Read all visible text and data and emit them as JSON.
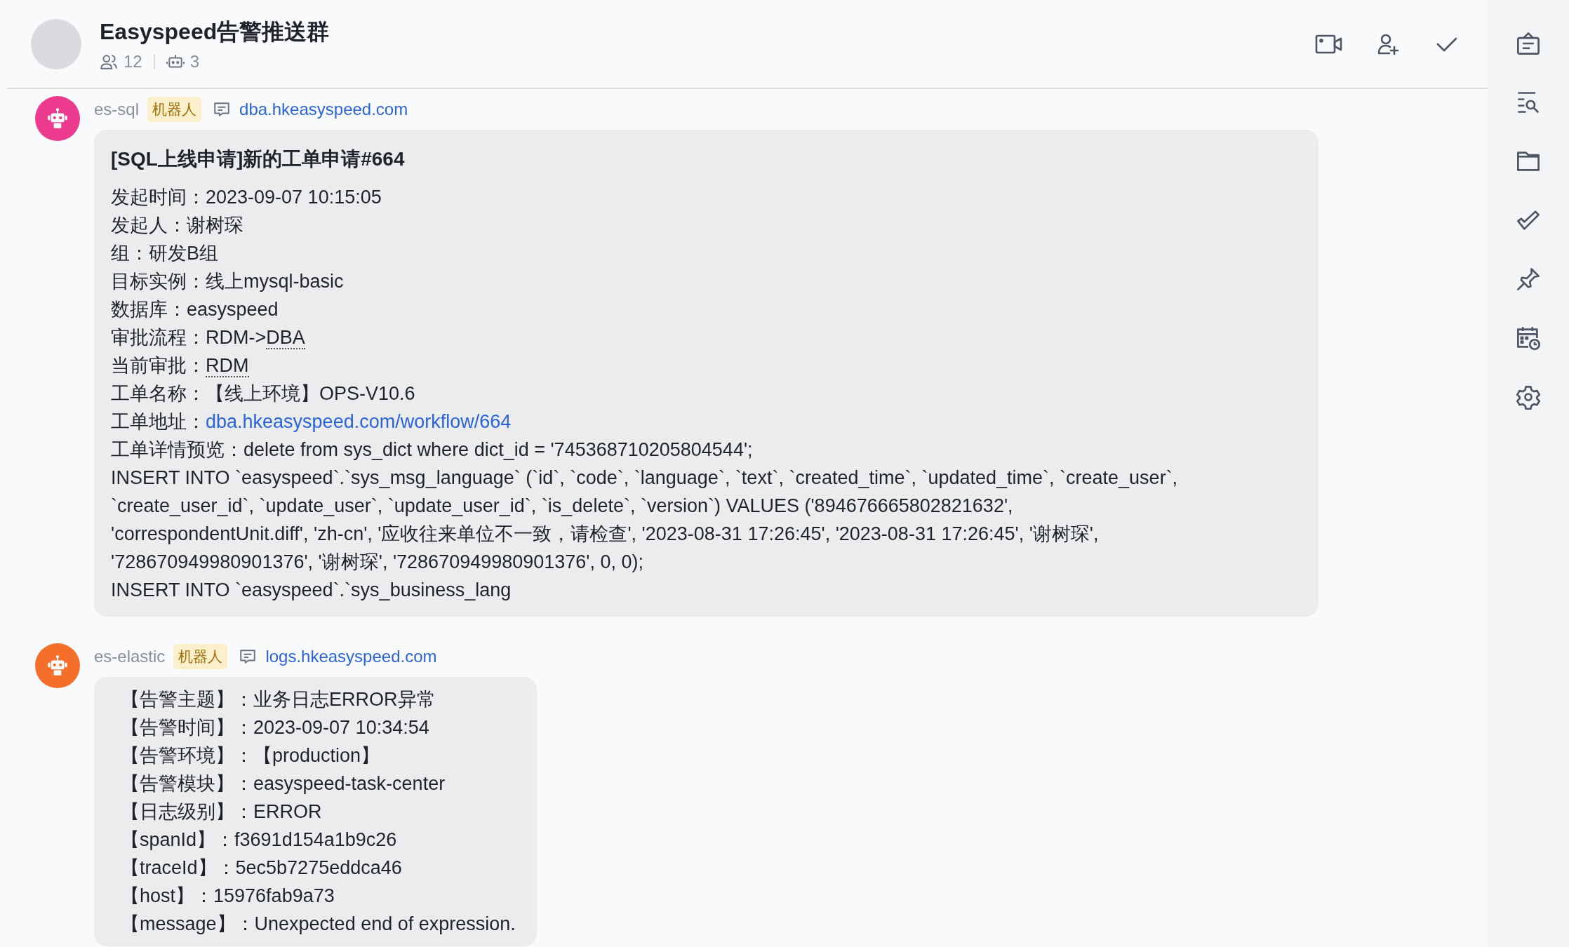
{
  "header": {
    "title": "Easyspeed告警推送群",
    "members": "12",
    "bots": "3"
  },
  "messages": [
    {
      "sender": "es-sql",
      "tag": "机器人",
      "link": "dba.hkeasyspeed.com",
      "color": "#ec3a8e",
      "title": "[SQL上线申请]新的工单申请#664",
      "lines": [
        [
          {
            "text": "发起时间：2023-09-07 10:15:05",
            "kind": "text"
          }
        ],
        [
          {
            "text": "发起人：谢树琛",
            "kind": "text"
          }
        ],
        [
          {
            "text": "组：研发B组",
            "kind": "text"
          }
        ],
        [
          {
            "text": "目标实例：线上mysql-basic",
            "kind": "text"
          }
        ],
        [
          {
            "text": "数据库：easyspeed",
            "kind": "text"
          }
        ],
        [
          {
            "text": "审批流程：RDM->",
            "kind": "text"
          },
          {
            "text": "DBA",
            "kind": "term"
          }
        ],
        [
          {
            "text": "当前审批：",
            "kind": "text"
          },
          {
            "text": "RDM",
            "kind": "term"
          }
        ],
        [
          {
            "text": "工单名称：【线上环境】OPS-V10.6",
            "kind": "text"
          }
        ],
        [
          {
            "text": "工单地址：",
            "kind": "text"
          },
          {
            "text": "dba.hkeasyspeed.com/workflow/664",
            "kind": "link"
          }
        ],
        [
          {
            "text": "工单详情预览：delete from sys_dict where dict_id = '745368710205804544';",
            "kind": "text"
          }
        ],
        [
          {
            "text": "INSERT INTO `easyspeed`.`sys_msg_language` (`id`, `code`, `language`, `text`, `created_time`, `updated_time`, `create_user`,",
            "kind": "text"
          }
        ],
        [
          {
            "text": "`create_user_id`, `update_user`, `update_user_id`, `is_delete`, `version`) VALUES ('894676665802821632',",
            "kind": "text"
          }
        ],
        [
          {
            "text": "'correspondentUnit.diff', 'zh-cn', '应收往来单位不一致，请检查', '2023-08-31 17:26:45', '2023-08-31 17:26:45', '谢树琛',",
            "kind": "text"
          }
        ],
        [
          {
            "text": "'728670949980901376', '谢树琛', '728670949980901376', 0, 0);",
            "kind": "text"
          }
        ],
        [
          {
            "text": "INSERT INTO `easyspeed`.`sys_business_lang",
            "kind": "text"
          }
        ]
      ]
    },
    {
      "sender": "es-elastic",
      "tag": "机器人",
      "link": "logs.hkeasyspeed.com",
      "color": "#f4702a",
      "lines": [
        [
          {
            "text": "【告警主题】：业务日志ERROR异常",
            "kind": "text"
          }
        ],
        [
          {
            "text": "【告警时间】：2023-09-07 10:34:54",
            "kind": "text"
          }
        ],
        [
          {
            "text": "【告警环境】：【production】",
            "kind": "text"
          }
        ],
        [
          {
            "text": "【告警模块】：easyspeed-task-center",
            "kind": "text"
          }
        ],
        [
          {
            "text": "【日志级别】：ERROR",
            "kind": "text"
          }
        ],
        [
          {
            "text": "【spanId】：f3691d154a1b9c26",
            "kind": "text"
          }
        ],
        [
          {
            "text": "【traceId】：5ec5b7275eddca46",
            "kind": "text"
          }
        ],
        [
          {
            "text": "【host】：15976fab9a73",
            "kind": "text"
          }
        ],
        [
          {
            "text": "【message】：Unexpected end of expression.",
            "kind": "text"
          }
        ]
      ]
    }
  ]
}
